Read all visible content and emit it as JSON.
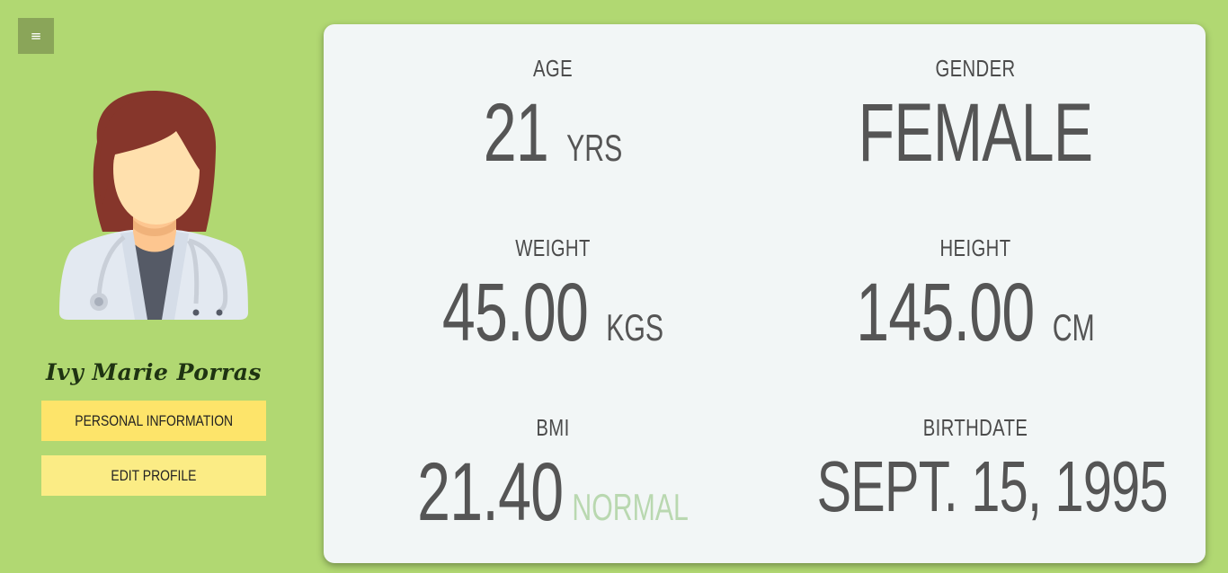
{
  "menu": {
    "icon": "menu-icon",
    "glyph": "≡"
  },
  "profile": {
    "name": "Ivy Marie Porras",
    "avatar": "doctor-avatar-icon",
    "buttons": {
      "personal_information": "PERSONAL INFORMATION",
      "edit_profile": "EDIT PROFILE"
    }
  },
  "stats": {
    "age": {
      "label": "AGE",
      "value": "21",
      "unit": "YRS"
    },
    "gender": {
      "label": "GENDER",
      "value": "FEMALE"
    },
    "weight": {
      "label": "WEIGHT",
      "value": "45.00",
      "unit": "KGS"
    },
    "height": {
      "label": "HEIGHT",
      "value": "145.00",
      "unit": "CM"
    },
    "bmi": {
      "label": "BMI",
      "value": "21.40",
      "status": "NORMAL"
    },
    "birthdate": {
      "label": "BIRTHDATE",
      "value": "SEPT. 15, 1995"
    }
  },
  "colors": {
    "background": "#b1d872",
    "menu_button": "#8aa559",
    "card": "#f2f6f6",
    "button_primary": "#fde46a",
    "button_secondary": "#fbec85",
    "bmi_status": "#b9d8b0"
  }
}
